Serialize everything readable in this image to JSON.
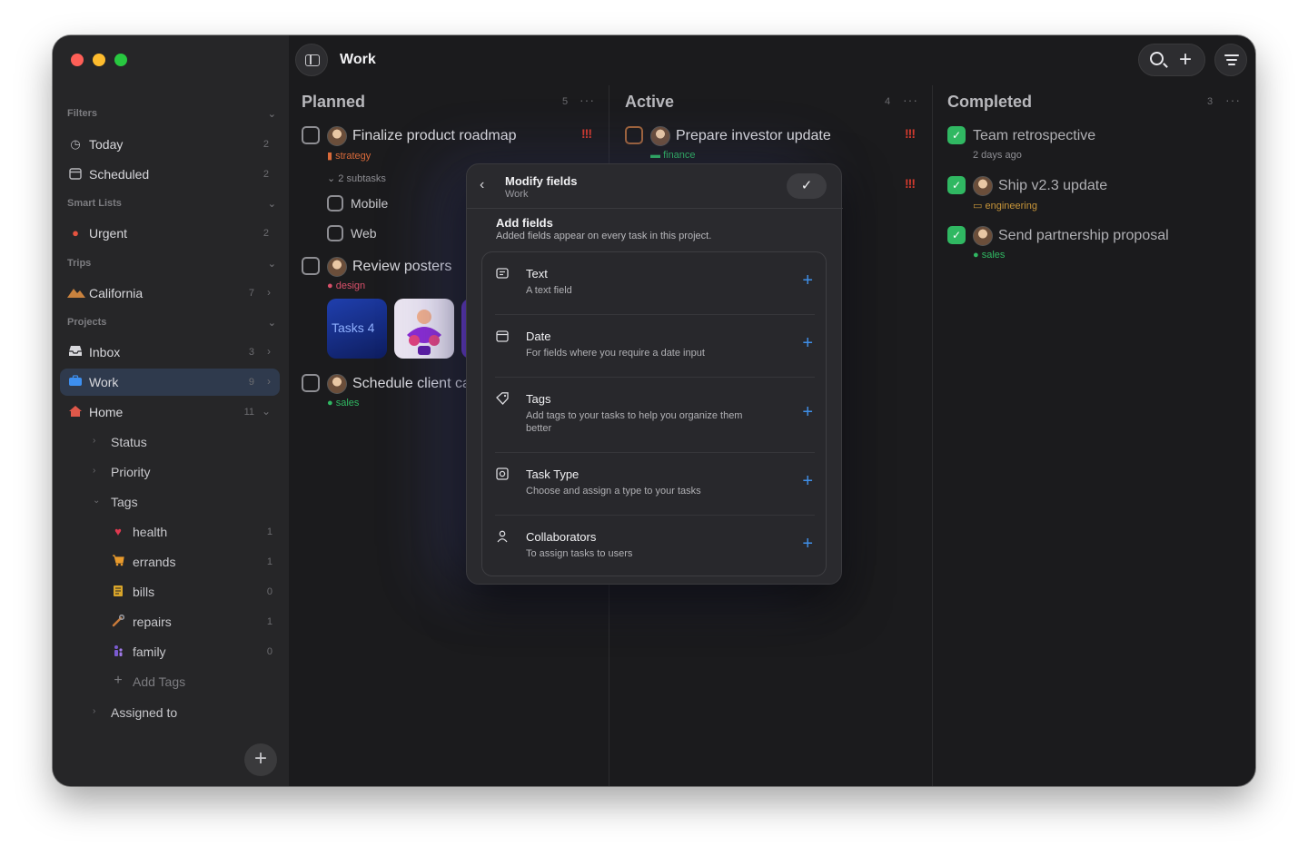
{
  "sidebar": {
    "sections": {
      "filters": "Filters",
      "smart_lists": "Smart Lists",
      "trips": "Trips",
      "projects": "Projects"
    },
    "today": {
      "label": "Today",
      "count": "2"
    },
    "scheduled": {
      "label": "Scheduled",
      "count": "2"
    },
    "urgent": {
      "label": "Urgent",
      "count": "2"
    },
    "california": {
      "label": "California",
      "count": "7"
    },
    "inbox": {
      "label": "Inbox",
      "count": "3"
    },
    "work": {
      "label": "Work",
      "count": "9"
    },
    "home": {
      "label": "Home",
      "count": "11"
    },
    "status": "Status",
    "priority": "Priority",
    "tags": "Tags",
    "tag_items": [
      {
        "label": "health",
        "count": "1",
        "icon": "heart-icon"
      },
      {
        "label": "errands",
        "count": "1",
        "icon": "cart-icon"
      },
      {
        "label": "bills",
        "count": "0",
        "icon": "receipt-icon"
      },
      {
        "label": "repairs",
        "count": "1",
        "icon": "wrench-icon"
      },
      {
        "label": "family",
        "count": "0",
        "icon": "family-icon"
      }
    ],
    "add_tags": "Add Tags",
    "assigned_to": "Assigned to"
  },
  "topbar": {
    "title": "Work"
  },
  "columns": {
    "planned": {
      "title": "Planned",
      "count": "5"
    },
    "active": {
      "title": "Active",
      "count": "4"
    },
    "completed": {
      "title": "Completed",
      "count": "3"
    }
  },
  "planned_tasks": {
    "roadmap": {
      "title": "Finalize product roadmap",
      "tag": "strategy",
      "priority": "!!!",
      "subtasks_label": "2 subtasks",
      "subtasks": [
        "Mobile",
        "Web"
      ]
    },
    "posters": {
      "title": "Review posters",
      "tag": "design",
      "thumb_text": "Tasks 4"
    },
    "client": {
      "title": "Schedule client ca",
      "tag": "sales"
    }
  },
  "active_tasks": {
    "investor": {
      "title": "Prepare investor update",
      "tag": "finance",
      "priority": "!!!"
    },
    "second_priority": "!!!"
  },
  "completed_tasks": [
    {
      "title": "Team retrospective",
      "meta": "2 days ago"
    },
    {
      "title": "Ship v2.3 update",
      "meta": "engineering"
    },
    {
      "title": "Send partnership proposal",
      "meta": "sales"
    }
  ],
  "modal": {
    "title": "Modify fields",
    "subtitle": "Work",
    "confirm": "✓",
    "add_title": "Add fields",
    "add_sub": "Added fields appear on every task in this project.",
    "fields": [
      {
        "name": "Text",
        "desc": "A text field",
        "icon": "text-icon"
      },
      {
        "name": "Date",
        "desc": "For fields where you require a date input",
        "icon": "calendar-icon"
      },
      {
        "name": "Tags",
        "desc": "Add tags to your tasks to help you organize them better",
        "icon": "tag-icon"
      },
      {
        "name": "Task Type",
        "desc": "Choose and assign a type to your tasks",
        "icon": "task-type-icon"
      },
      {
        "name": "Collaborators",
        "desc": "To assign tasks to users",
        "icon": "person-icon"
      }
    ]
  },
  "colors": {
    "accent_blue": "#3f8fe8",
    "priority_red": "#d03a2e",
    "done_green": "#30b862",
    "tag_strategy": "#d96a3a",
    "tag_design": "#d9506a",
    "tag_finance": "#30b862",
    "tag_engineering": "#c8963a",
    "tag_sales": "#30b862"
  }
}
